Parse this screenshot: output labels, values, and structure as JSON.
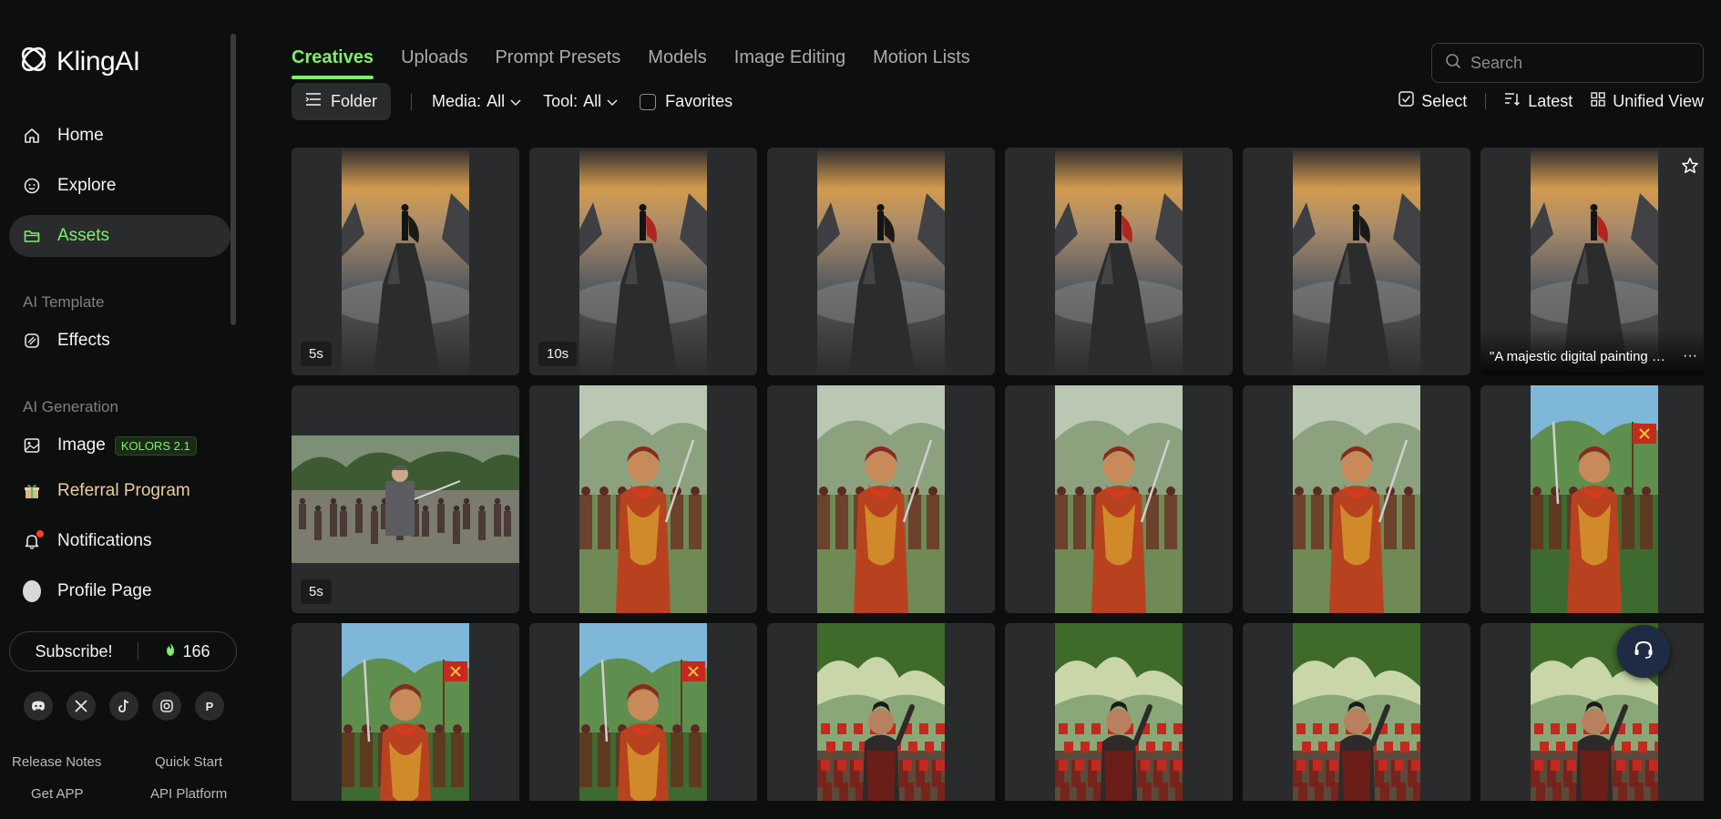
{
  "app": {
    "name": "KlingAI"
  },
  "sidebar": {
    "nav": [
      {
        "label": "Home"
      },
      {
        "label": "Explore"
      },
      {
        "label": "Assets"
      }
    ],
    "section_template": "AI Template",
    "effects_label": "Effects",
    "section_generation": "AI Generation",
    "image_label": "Image",
    "image_badge": "KOLORS 2.1",
    "referral_label": "Referral Program",
    "notifications_label": "Notifications",
    "profile_label": "Profile Page",
    "subscribe_label": "Subscribe!",
    "credits": "166",
    "socials": [
      "discord",
      "x",
      "tiktok",
      "instagram",
      "P"
    ],
    "footer_links": [
      "Release Notes",
      "Quick Start",
      "Get APP",
      "API Platform"
    ]
  },
  "tabs": [
    "Creatives",
    "Uploads",
    "Prompt Presets",
    "Models",
    "Image Editing",
    "Motion Lists"
  ],
  "active_tab": "Creatives",
  "search": {
    "placeholder": "Search"
  },
  "toolbar": {
    "folder_label": "Folder",
    "media_label": "Media:",
    "media_value": "All",
    "tool_label": "Tool:",
    "tool_value": "All",
    "favorites_label": "Favorites",
    "select_label": "Select",
    "sort_label": "Latest",
    "view_label": "Unified View"
  },
  "grid": {
    "rows": [
      [
        {
          "kind": "mountain",
          "duration": "5s"
        },
        {
          "kind": "mountain",
          "duration": "10s"
        },
        {
          "kind": "mountain"
        },
        {
          "kind": "mountain"
        },
        {
          "kind": "mountain"
        },
        {
          "kind": "mountain",
          "caption": "\"A majestic digital painting of a lone warrior standing atop a mountain\"",
          "hovered": true
        }
      ],
      [
        {
          "kind": "army-photo",
          "duration": "5s"
        },
        {
          "kind": "general"
        },
        {
          "kind": "general"
        },
        {
          "kind": "general"
        },
        {
          "kind": "general"
        },
        {
          "kind": "general-flag"
        }
      ],
      [
        {
          "kind": "general-flag"
        },
        {
          "kind": "general-flag"
        },
        {
          "kind": "forest-general"
        },
        {
          "kind": "forest-general"
        },
        {
          "kind": "forest-general"
        },
        {
          "kind": "forest-general"
        }
      ]
    ]
  },
  "colors": {
    "accent": "#7df06a",
    "background": "#0d0e0e",
    "card": "#2a2b2c"
  }
}
